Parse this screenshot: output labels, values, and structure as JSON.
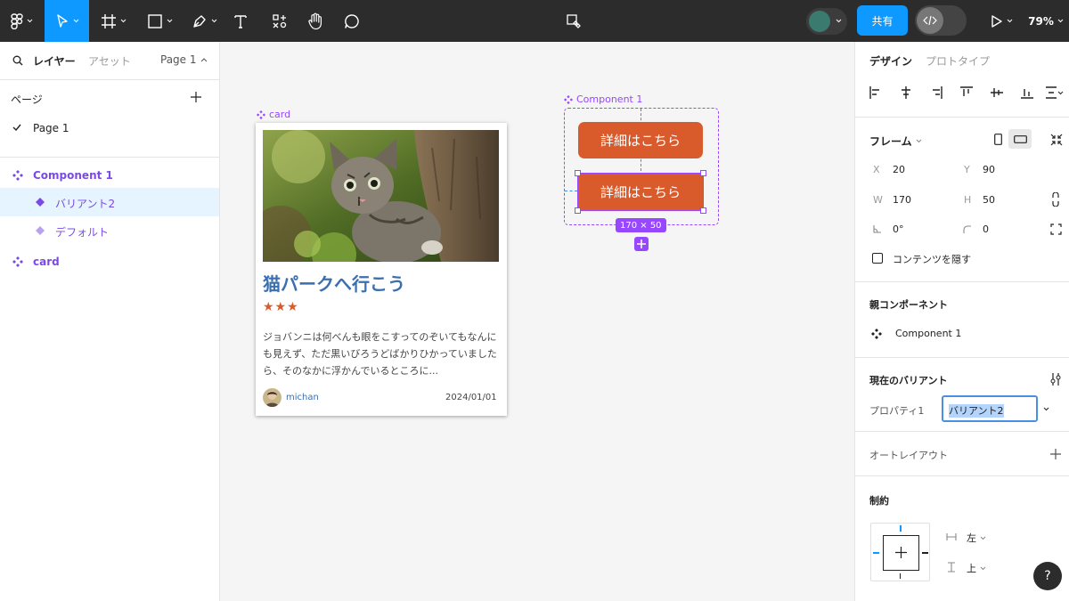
{
  "toolbar": {
    "zoom": "79%",
    "share_label": "共有",
    "colors": {
      "bg": "#2c2c2c",
      "active": "#0d99ff",
      "share": "#0d99ff"
    }
  },
  "left_panel": {
    "tabs": {
      "layers": "レイヤー",
      "assets": "アセット"
    },
    "page_selector": "Page 1",
    "pages_title": "ページ",
    "pages": [
      {
        "label": "Page 1",
        "selected": true
      }
    ],
    "layers": [
      {
        "label": "Component 1",
        "kind": "component-set"
      },
      {
        "label": "バリアント2",
        "kind": "variant",
        "selected": true
      },
      {
        "label": "デフォルト",
        "kind": "variant"
      },
      {
        "label": "card",
        "kind": "component"
      }
    ]
  },
  "canvas": {
    "card_frame_label": "card",
    "component_label": "Component 1",
    "card": {
      "title": "猫パークへ行こう",
      "stars": "★★★",
      "body": "ジョバンニは何べんも眼をこすってのぞいてもなんにも見えず、ただ黒いびろうどばかりひかっていましたら、そのなかに浮かんでいるところに...",
      "author": "michan",
      "date": "2024/01/01"
    },
    "button_label": "詳細はこちら",
    "size_badge": "170 × 50",
    "accent_color": "#d95b2b",
    "selection_color": "#9747ff"
  },
  "right_panel": {
    "tabs": {
      "design": "デザイン",
      "prototype": "プロトタイプ"
    },
    "frame_title": "フレーム",
    "fields": {
      "x_label": "X",
      "x": "20",
      "y_label": "Y",
      "y": "90",
      "w_label": "W",
      "w": "170",
      "h_label": "H",
      "h": "50",
      "rotation": "0°",
      "radius": "0"
    },
    "clip_label": "コンテンツを隠す",
    "parent_title": "親コンポーネント",
    "parent_name": "Component 1",
    "variant_title": "現在のバリアント",
    "property_label": "プロパティ1",
    "property_value": "バリアント2",
    "autolayout_label": "オートレイアウト",
    "constraints_title": "制約",
    "constraint_h": "左",
    "constraint_v": "上",
    "help": "?"
  }
}
